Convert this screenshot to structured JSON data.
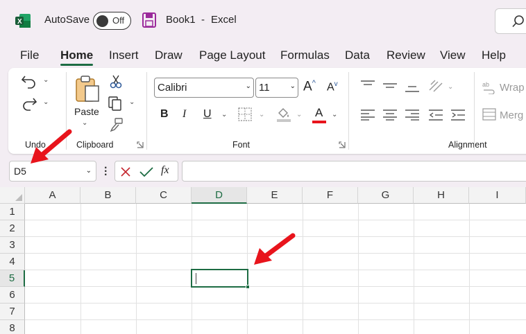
{
  "titlebar": {
    "autosave_label": "AutoSave",
    "autosave_state": "Off",
    "workbook": "Book1",
    "separator": "-",
    "app": "Excel"
  },
  "tabs": [
    "File",
    "Home",
    "Insert",
    "Draw",
    "Page Layout",
    "Formulas",
    "Data",
    "Review",
    "View",
    "Help"
  ],
  "active_tab": "Home",
  "ribbon": {
    "undo_group": "Undo",
    "clipboard_group": "Clipboard",
    "paste_label": "Paste",
    "font_group": "Font",
    "font_name": "Calibri",
    "font_size": "11",
    "bold": "B",
    "italic": "I",
    "underline": "U",
    "font_color_letter": "A",
    "alignment_group": "Alignment",
    "wrap_label": "Wrap",
    "merge_label": "Merg"
  },
  "formula_bar": {
    "name_box": "D5",
    "fx": "fx",
    "formula": ""
  },
  "grid": {
    "columns": [
      "A",
      "B",
      "C",
      "D",
      "E",
      "F",
      "G",
      "H",
      "I"
    ],
    "rows": [
      "1",
      "2",
      "3",
      "4",
      "5",
      "6",
      "7",
      "8"
    ],
    "selected_column": "D",
    "selected_row": "5"
  },
  "colors": {
    "accent": "#1d6c43",
    "annotation_arrow": "#e8141c"
  }
}
